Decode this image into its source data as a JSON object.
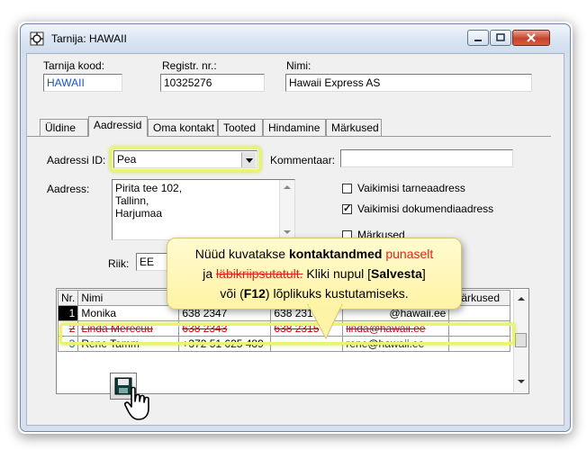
{
  "window": {
    "title": "Tarnija: HAWAII"
  },
  "header": {
    "code_label": "Tarnija kood:",
    "code_value": "HAWAII",
    "reg_label": "Registr. nr.:",
    "reg_value": "10325276",
    "name_label": "Nimi:",
    "name_value": "Hawaii Express AS"
  },
  "tabs": [
    {
      "label": "Üldine"
    },
    {
      "label": "Aadressid"
    },
    {
      "label": "Oma kontakt"
    },
    {
      "label": "Tooted"
    },
    {
      "label": "Hindamine"
    },
    {
      "label": "Märkused"
    }
  ],
  "address": {
    "id_label": "Aadressi ID:",
    "id_value": "Pea",
    "comment_label": "Kommentaar:",
    "comment_value": "",
    "address_label": "Aadress:",
    "address_lines": [
      "Pirita tee 102,",
      "Tallinn,",
      "Harjumaa"
    ],
    "default_delivery_label": "Vaikimisi tarneaadress",
    "default_delivery_checked": false,
    "default_document_label": "Vaikimisi dokumendiaadress",
    "default_document_checked": true,
    "notes_label": "Märkused",
    "country_label": "Riik:",
    "country_value": "EE"
  },
  "contacts": {
    "columns": [
      "Nr.",
      "Nimi",
      "",
      "",
      "",
      "Märkused"
    ],
    "rows": [
      {
        "nr": "1",
        "name": "Monika",
        "phone": "638 2347",
        "fax": "638 2315",
        "email": "@hawaii.ee",
        "notes": "",
        "deleted": false,
        "selected": true
      },
      {
        "nr": "2",
        "name": "Linda Merecuu",
        "phone": "638 2343",
        "fax": "638 2315",
        "email": "linda@hawaii.ee",
        "notes": "",
        "deleted": true,
        "selected": false
      },
      {
        "nr": "3",
        "name": "Rene Tamm",
        "phone": "+372 51 625 489",
        "fax": "",
        "email": "rene@hawaii.ee",
        "notes": "",
        "deleted": false,
        "selected": false
      }
    ]
  },
  "callout": {
    "line1_a": "Nüüd kuvatakse ",
    "line1_b": "kontaktandmed",
    "line1_c": " punaselt",
    "line2_a": "ja ",
    "line2_b": "läbikriipsutatult.",
    "line2_c": " Kliki nupul [",
    "line2_d": "Salvesta",
    "line2_e": "]",
    "line3_a": "või (",
    "line3_b": "F12",
    "line3_c": ") lõplikuks kustutamiseks."
  },
  "icons": {
    "app": "app-icon",
    "save": "floppy-disk-icon",
    "cursor": "hand-pointer-icon"
  },
  "colors": {
    "highlight": "#e9f56a",
    "deleted": "#d40000",
    "callout_bg": "#fff3a5",
    "titlebar": "#dbe6f3"
  }
}
